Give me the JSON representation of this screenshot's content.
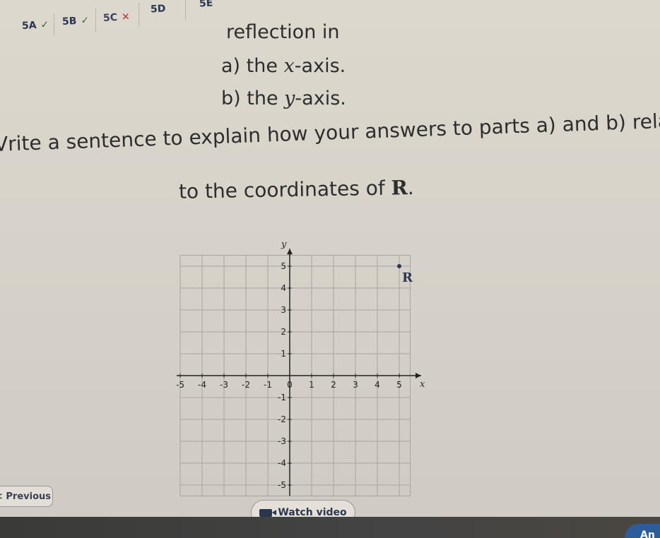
{
  "tabs": [
    {
      "label": "5A",
      "mark": "✓",
      "state": "done"
    },
    {
      "label": "5B",
      "mark": "✓",
      "state": "done"
    },
    {
      "label": "5C",
      "mark": "✕",
      "state": "wrong"
    },
    {
      "label": "5D",
      "mark": "",
      "state": "open"
    },
    {
      "label": "5E",
      "mark": "",
      "state": "open"
    }
  ],
  "question": {
    "reflection": "reflection in",
    "part_a_prefix": "a) the ",
    "part_a_var": "x",
    "part_a_suffix": "-axis.",
    "part_b_prefix": "b) the ",
    "part_b_var": "y",
    "part_b_suffix": "-axis.",
    "write": "Vrite a sentence to explain how your answers to parts a) and b) relat",
    "coords_prefix": "to the coordinates of ",
    "coords_point": "R",
    "coords_suffix": "."
  },
  "graph": {
    "x_axis_label": "x",
    "y_axis_label": "y",
    "x_ticks": [
      "-5",
      "-4",
      "-3",
      "-2",
      "-1",
      "0",
      "1",
      "2",
      "3",
      "4",
      "5"
    ],
    "y_ticks": [
      "5",
      "4",
      "3",
      "2",
      "1",
      "-1",
      "-2",
      "-3",
      "-4",
      "-5"
    ],
    "point": {
      "label": "R",
      "x": 5,
      "y": 5
    },
    "point_color": "#2b3650"
  },
  "buttons": {
    "previous": "< Previous",
    "watch_video": "Watch video",
    "corner": "An"
  },
  "colors": {
    "accent": "#2b3650",
    "grid": "#a9a59d"
  }
}
